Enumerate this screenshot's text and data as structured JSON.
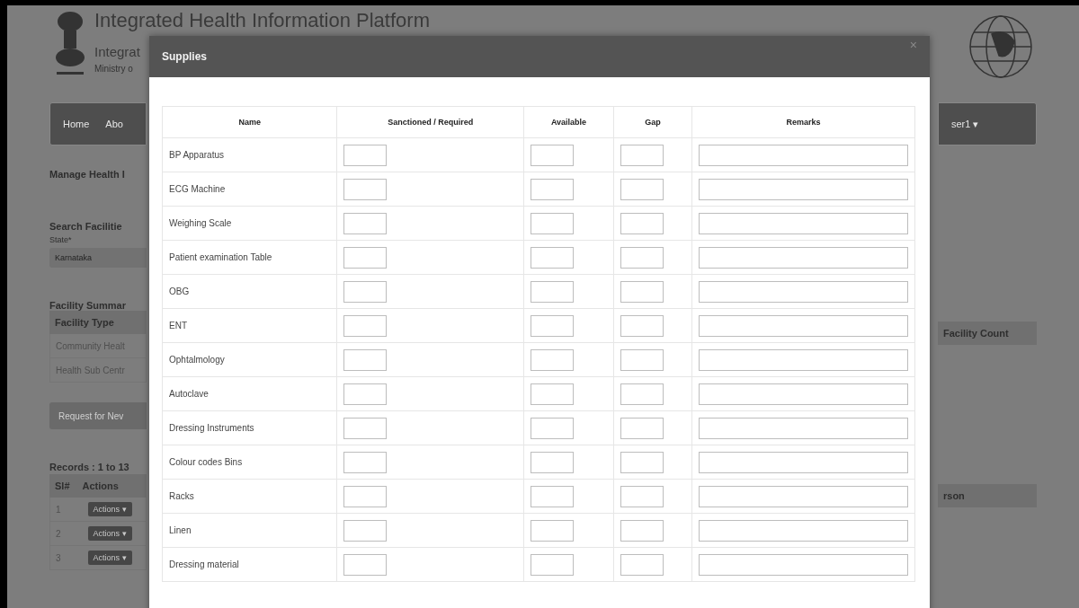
{
  "header": {
    "title": "Integrated Health Information Platform",
    "subtitle": "Integrat",
    "ministry": "Ministry o"
  },
  "nav": {
    "left": [
      "Home",
      "Abo"
    ],
    "right": "ser1 ▾"
  },
  "page": {
    "heading": "Manage Health I",
    "search_title": "Search Facilitie",
    "state_label": "State*",
    "state_value": "Karnataka",
    "summary_title": "Facility Summar",
    "summary_type_column": "Facility Type",
    "summary_count_column": "Facility Count",
    "summary_rows": [
      "Community Healt",
      "Health Sub Centr"
    ],
    "request_button": "Request for Nev",
    "records": "Records : 1 to 13",
    "records_columns": [
      "Sl#",
      "Actions"
    ],
    "records_right_column": "rson",
    "records_rows": [
      {
        "sl": "1",
        "action": "Actions ▾"
      },
      {
        "sl": "2",
        "action": "Actions ▾"
      },
      {
        "sl": "3",
        "action": "Actions ▾"
      }
    ]
  },
  "modal": {
    "title": "Supplies",
    "close": "×",
    "columns": [
      "Name",
      "Sanctioned / Required",
      "Available",
      "Gap",
      "Remarks"
    ],
    "rows": [
      "BP Apparatus",
      "ECG Machine",
      "Weighing Scale",
      "Patient examination Table",
      "OBG",
      "ENT",
      "Ophtalmology",
      "Autoclave",
      "Dressing Instruments",
      "Colour codes Bins",
      "Racks",
      "Linen",
      "Dressing material"
    ]
  }
}
